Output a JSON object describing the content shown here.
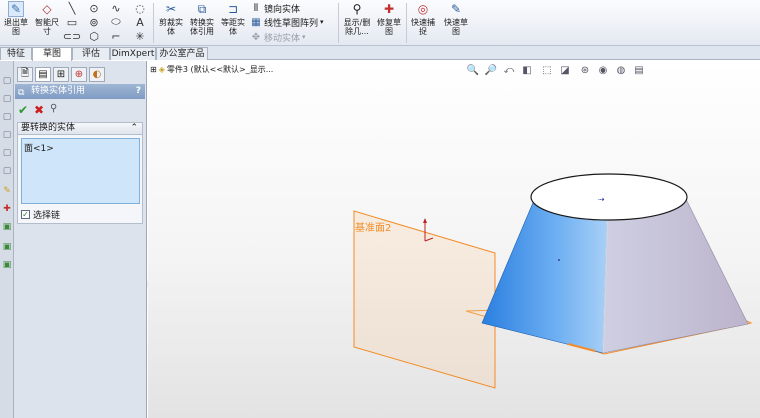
{
  "ribbon": {
    "exit_sketch": "退出草\n图",
    "smart_dim": "智能尺\n寸",
    "trim": "剪裁实\n体",
    "convert": "转换实\n体引用",
    "offset": "等距实\n体",
    "mirror": "镜向实体",
    "linear_pattern": "线性草图阵列",
    "move": "移动实体",
    "display_delete": "显示/删\n除几...",
    "repair": "修复草\n图",
    "quick_snap": "快速捕\n捉",
    "quick_sketch": "快速草\n图"
  },
  "tabs": [
    "特征",
    "草图",
    "评估",
    "DimXpert",
    "办公室产品"
  ],
  "active_tab": "草图",
  "pm": {
    "title": "转换实体引用",
    "help": "?",
    "group_title": "要转换的实体",
    "selection": "面<1>",
    "select_chain": "选择链"
  },
  "viewport": {
    "tree": "零件3 (默认<<默认>_显示..."
  },
  "plane_label": "基准面2",
  "colors": {
    "ribbon_bg": "#e4e9f1",
    "pm_title": "#8aa4c9",
    "selection_box": "#cfe6fa",
    "plane": "#f28c28",
    "face_highlight": "#3d8fe6"
  }
}
